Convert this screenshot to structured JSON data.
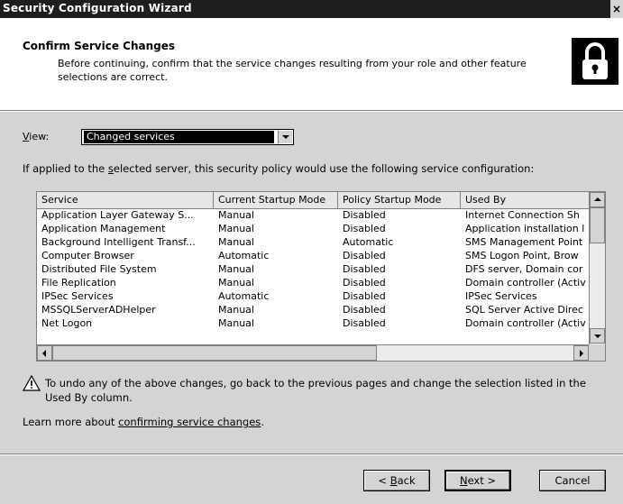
{
  "window": {
    "title": "Security Configuration Wizard",
    "close_glyph": "×"
  },
  "header": {
    "title": "Confirm Service Changes",
    "description": "Before continuing, confirm that the service changes resulting from your role and other feature selections are correct.",
    "icon": "lock-icon"
  },
  "view": {
    "label_prefix": "",
    "label_accel": "V",
    "label_rest": "iew:",
    "selected": "Changed services"
  },
  "intro": {
    "before": "If applied to the ",
    "accel": "s",
    "after": "elected server, this security policy would use the following service configuration:"
  },
  "table": {
    "columns": [
      "Service",
      "Current Startup Mode",
      "Policy Startup Mode",
      "Used By"
    ],
    "rows": [
      [
        "Application Layer Gateway S...",
        "Manual",
        "Disabled",
        "Internet Connection Sh"
      ],
      [
        "Application Management",
        "Manual",
        "Disabled",
        "Application installation l"
      ],
      [
        "Background Intelligent Transf...",
        "Manual",
        "Automatic",
        "SMS Management Point"
      ],
      [
        "Computer Browser",
        "Automatic",
        "Disabled",
        "SMS Logon Point, Brow"
      ],
      [
        "Distributed File System",
        "Manual",
        "Disabled",
        "DFS server, Domain cor"
      ],
      [
        "File Replication",
        "Manual",
        "Disabled",
        "Domain controller (Activ"
      ],
      [
        "IPSec Services",
        "Automatic",
        "Disabled",
        "IPSec Services"
      ],
      [
        "MSSQLServerADHelper",
        "Manual",
        "Disabled",
        "SQL Server Active Direc"
      ],
      [
        "Net Logon",
        "Manual",
        "Disabled",
        "Domain controller (Activ"
      ]
    ]
  },
  "warning": {
    "icon": "warning-icon",
    "text": "To undo any of the above changes, go back to the previous pages and change the selection listed in the Used By column."
  },
  "learn": {
    "prefix": "Learn more about ",
    "link": "confirming service changes",
    "suffix": "."
  },
  "buttons": {
    "back": {
      "lt": "< ",
      "accel": "B",
      "rest": "ack"
    },
    "next": {
      "accel": "N",
      "rest": "ext >"
    },
    "cancel": "Cancel"
  }
}
